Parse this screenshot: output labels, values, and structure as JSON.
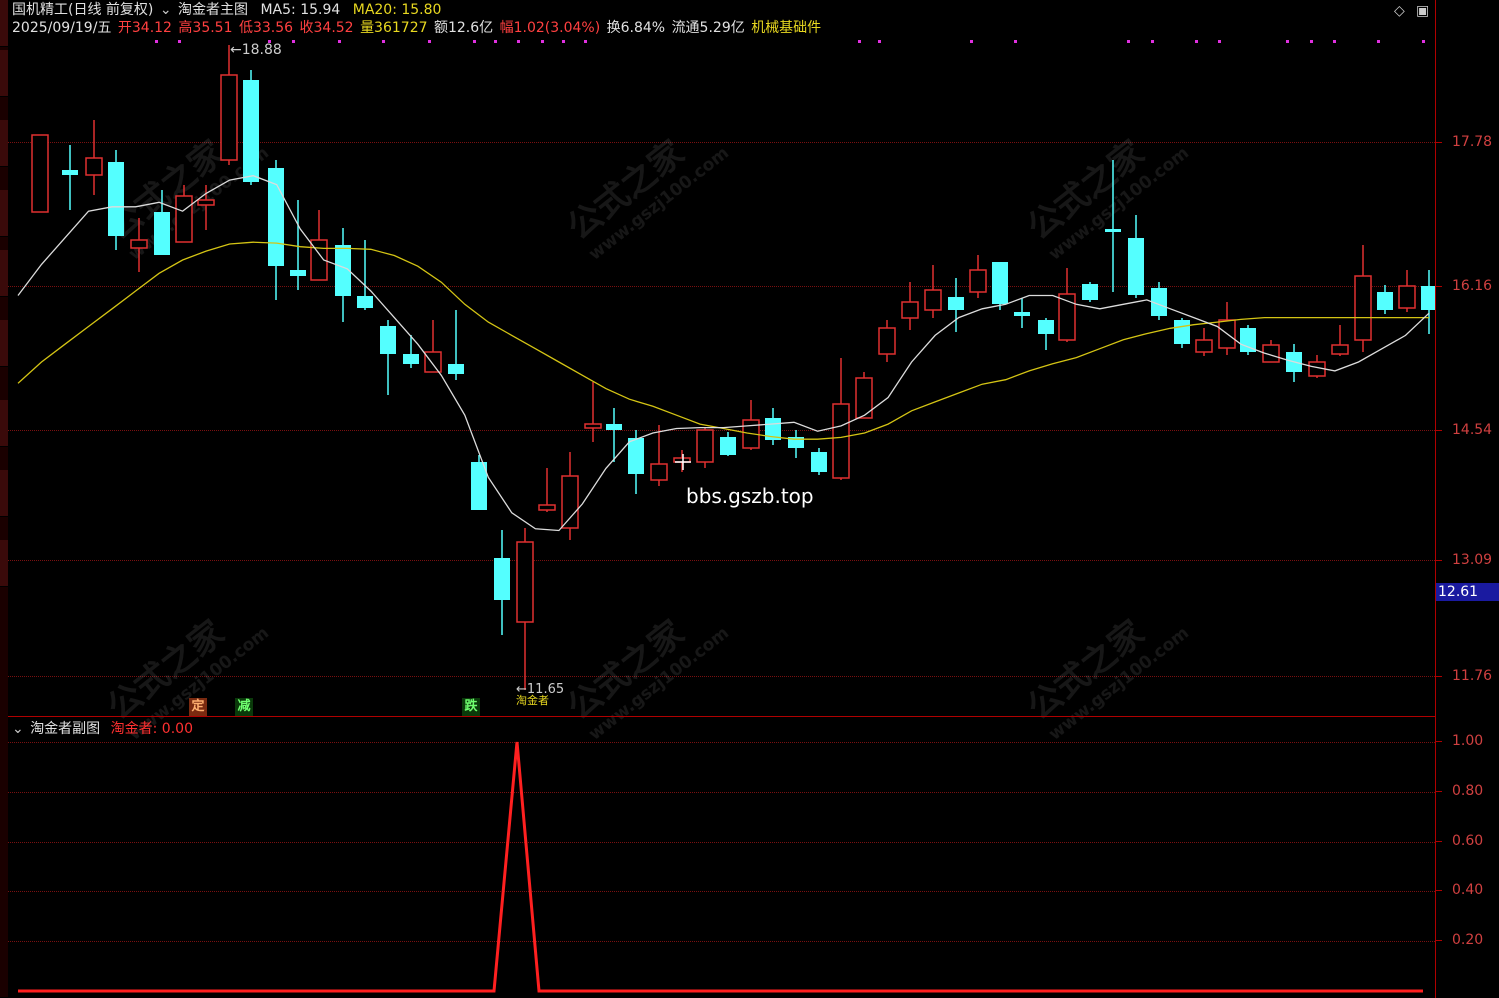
{
  "header": {
    "stock_name": "国机精工(日线 前复权)",
    "indicator_main": "淘金者主图",
    "ma5_label": "MA5: 15.94",
    "ma20_label": "MA20: 15.80",
    "date": "2025/09/19/五",
    "open": "开34.12",
    "high": "高35.51",
    "low": "低33.56",
    "close": "收34.52",
    "volume": "量361727",
    "amount": "额12.6亿",
    "change": "幅1.02(3.04%)",
    "turnover": "换6.84%",
    "float": "流通5.29亿",
    "sector": "机械基础件"
  },
  "main_axis": {
    "ticks": [
      "17.78",
      "16.16",
      "14.54",
      "13.09",
      "11.76"
    ],
    "current_price": "12.61"
  },
  "sub_panel": {
    "title": "淘金者副图",
    "value_label": "淘金者: 0.00",
    "ticks": [
      "1.00",
      "0.80",
      "0.60",
      "0.40",
      "0.20"
    ]
  },
  "annotations": {
    "high_marker": "18.88",
    "low_marker": "11.65",
    "low_marker_sub": "淘金者",
    "signal_1": "定",
    "signal_2": "减",
    "signal_3": "跌",
    "watermark_url": "bbs.gszb.top",
    "watermark_brand": "公式之家",
    "watermark_site": "www.gszj100.com"
  },
  "colors": {
    "up": "#e03030",
    "down": "#54ffff",
    "ma5": "#dcdcdc",
    "ma20": "#d4c414",
    "osc": "#ff2020"
  },
  "chart_data": {
    "type": "candlestick",
    "ylim": [
      11.1,
      19.0
    ],
    "series": [
      {
        "name": "MA5",
        "values": [
          16.05,
          16.4,
          16.7,
          17.0,
          17.05,
          17.05,
          17.1,
          17.0,
          17.2,
          17.35,
          17.4,
          17.3,
          16.8,
          16.45,
          16.35,
          16.1,
          15.8,
          15.5,
          15.15,
          14.7,
          14.0,
          13.6,
          13.42,
          13.4,
          13.7,
          14.1,
          14.4,
          14.5,
          14.55,
          14.56,
          14.56,
          14.58,
          14.6,
          14.62,
          14.52,
          14.58,
          14.7,
          14.9,
          15.3,
          15.6,
          15.8,
          15.9,
          15.95,
          16.05,
          16.05,
          15.95,
          15.9,
          15.95,
          16.0,
          15.9,
          15.8,
          15.7,
          15.5,
          15.4,
          15.32,
          15.25,
          15.2,
          15.3,
          15.45,
          15.6,
          15.85
        ]
      },
      {
        "name": "MA20",
        "values": [
          15.06,
          15.3,
          15.5,
          15.7,
          15.9,
          16.1,
          16.3,
          16.45,
          16.55,
          16.63,
          16.65,
          16.64,
          16.6,
          16.58,
          16.58,
          16.57,
          16.5,
          16.38,
          16.2,
          15.95,
          15.75,
          15.6,
          15.45,
          15.3,
          15.15,
          15.0,
          14.88,
          14.8,
          14.7,
          14.6,
          14.55,
          14.5,
          14.46,
          14.43,
          14.43,
          14.45,
          14.5,
          14.6,
          14.75,
          14.85,
          14.95,
          15.05,
          15.1,
          15.2,
          15.28,
          15.35,
          15.45,
          15.55,
          15.62,
          15.68,
          15.72,
          15.75,
          15.78,
          15.8,
          15.8,
          15.8,
          15.8,
          15.8,
          15.8,
          15.8,
          15.8
        ]
      }
    ]
  }
}
